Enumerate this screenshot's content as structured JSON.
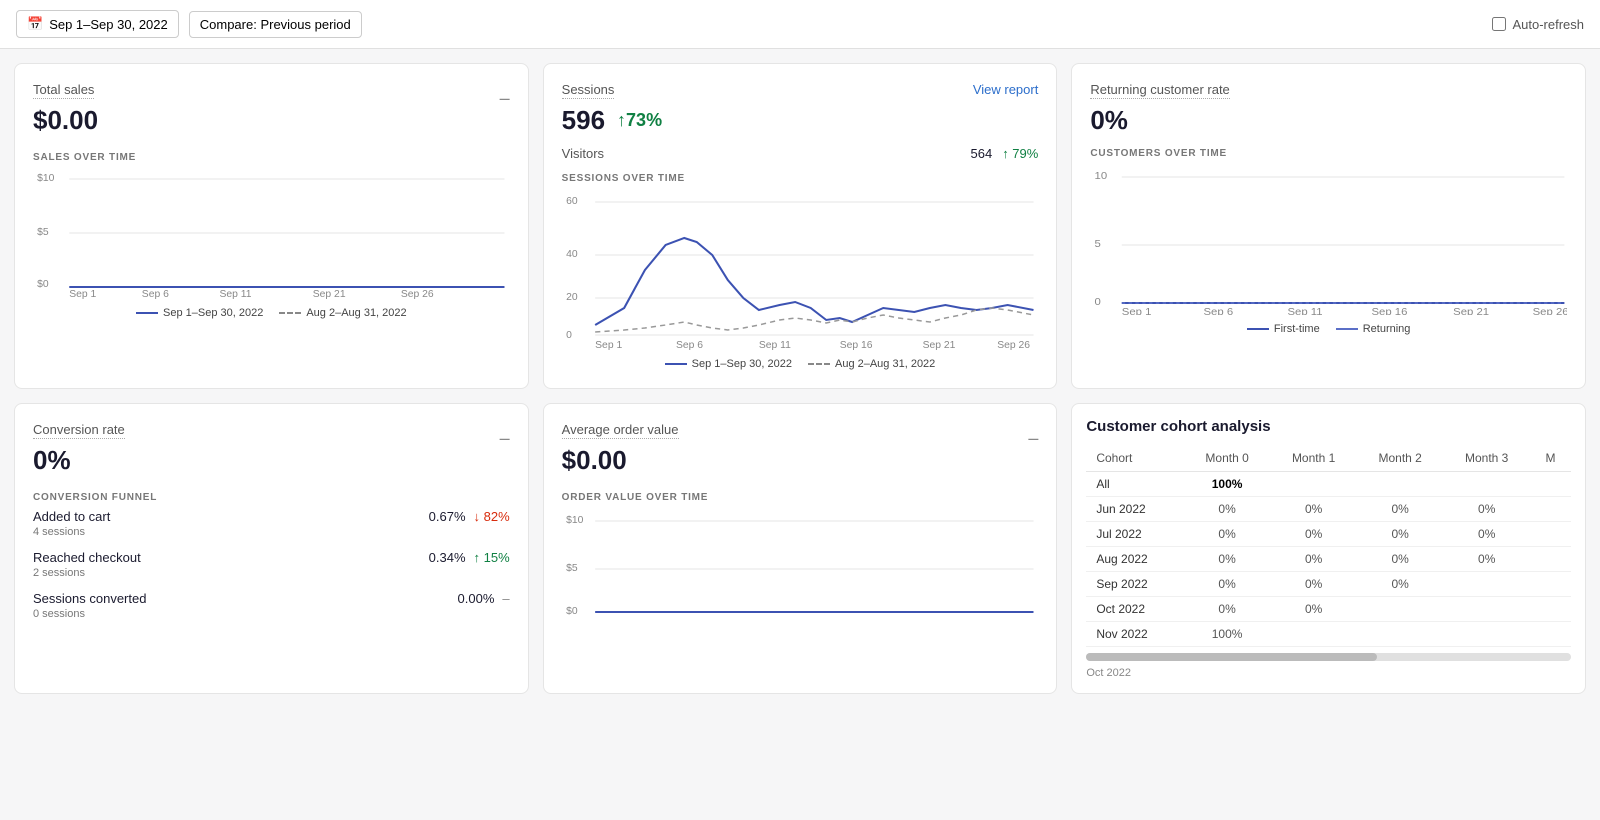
{
  "topbar": {
    "date_range": "Sep 1–Sep 30, 2022",
    "compare": "Compare: Previous period",
    "auto_refresh": "Auto-refresh"
  },
  "total_sales": {
    "title": "Total sales",
    "value": "$0.00",
    "section_label": "SALES OVER TIME",
    "legend_current": "Sep 1–Sep 30, 2022",
    "legend_prev": "Aug 2–Aug 31, 2022",
    "y_labels": [
      "$10",
      "$5",
      "$0"
    ],
    "x_labels": [
      "Sep 1",
      "Sep 6",
      "Sep 11",
      "Sep 21",
      "Sep 26"
    ]
  },
  "sessions": {
    "title": "Sessions",
    "value": "596",
    "change": "↑73%",
    "view_report": "View report",
    "visitors_label": "Visitors",
    "visitors_count": "564",
    "visitors_pct": "↑ 79%",
    "section_label": "SESSIONS OVER TIME",
    "legend_current": "Sep 1–Sep 30, 2022",
    "legend_prev": "Aug 2–Aug 31, 2022",
    "y_labels": [
      "60",
      "40",
      "20",
      "0"
    ],
    "x_labels": [
      "Sep 1",
      "Sep 6",
      "Sep 11",
      "Sep 16",
      "Sep 21",
      "Sep 26"
    ]
  },
  "returning": {
    "title": "Returning customer rate",
    "value": "0%",
    "section_label": "CUSTOMERS OVER TIME",
    "legend_first": "First-time",
    "legend_returning": "Returning",
    "y_labels": [
      "10",
      "5",
      "0"
    ],
    "x_labels": [
      "Sep 1",
      "Sep 6",
      "Sep 11",
      "Sep 16",
      "Sep 21",
      "Sep 26"
    ]
  },
  "conversion": {
    "title": "Conversion rate",
    "value": "0%",
    "section_label": "CONVERSION FUNNEL",
    "funnel": [
      {
        "label": "Added to cart",
        "sub": "4 sessions",
        "pct": "0.67%",
        "change": "↓ 82%",
        "dir": "down"
      },
      {
        "label": "Reached checkout",
        "sub": "2 sessions",
        "pct": "0.34%",
        "change": "↑ 15%",
        "dir": "up"
      },
      {
        "label": "Sessions converted",
        "sub": "0 sessions",
        "pct": "0.00%",
        "change": "–",
        "dir": "none"
      }
    ]
  },
  "avg_order": {
    "title": "Average order value",
    "value": "$0.00",
    "section_label": "ORDER VALUE OVER TIME",
    "y_labels": [
      "$10",
      "$5",
      "$0"
    ]
  },
  "cohort": {
    "title": "Customer cohort analysis",
    "columns": [
      "Cohort",
      "Month 0",
      "Month 1",
      "Month 2",
      "Month 3",
      "M..."
    ],
    "month_label": "Month",
    "rows": [
      {
        "cohort": "All",
        "m0": "100%",
        "m1": "",
        "m2": "",
        "m3": "",
        "m4": ""
      },
      {
        "cohort": "Jun 2022",
        "m0": "0%",
        "m1": "0%",
        "m2": "0%",
        "m3": "0%",
        "m4": ""
      },
      {
        "cohort": "Jul 2022",
        "m0": "0%",
        "m1": "0%",
        "m2": "0%",
        "m3": "0%",
        "m4": ""
      },
      {
        "cohort": "Aug 2022",
        "m0": "0%",
        "m1": "0%",
        "m2": "0%",
        "m3": "0%",
        "m4": ""
      },
      {
        "cohort": "Sep 2022",
        "m0": "0%",
        "m1": "0%",
        "m2": "0%",
        "m3": "",
        "m4": ""
      },
      {
        "cohort": "Oct 2022",
        "m0": "0%",
        "m1": "0%",
        "m2": "",
        "m3": "",
        "m4": ""
      },
      {
        "cohort": "Nov 2022",
        "m0": "100%",
        "m1": "",
        "m2": "",
        "m3": "",
        "m4": ""
      }
    ],
    "footer": "Oct 2022"
  },
  "colors": {
    "blue": "#3c52b2",
    "blue_light": "#5b6fc7",
    "green": "#108043",
    "red": "#d82c0d",
    "dashed": "#999"
  }
}
